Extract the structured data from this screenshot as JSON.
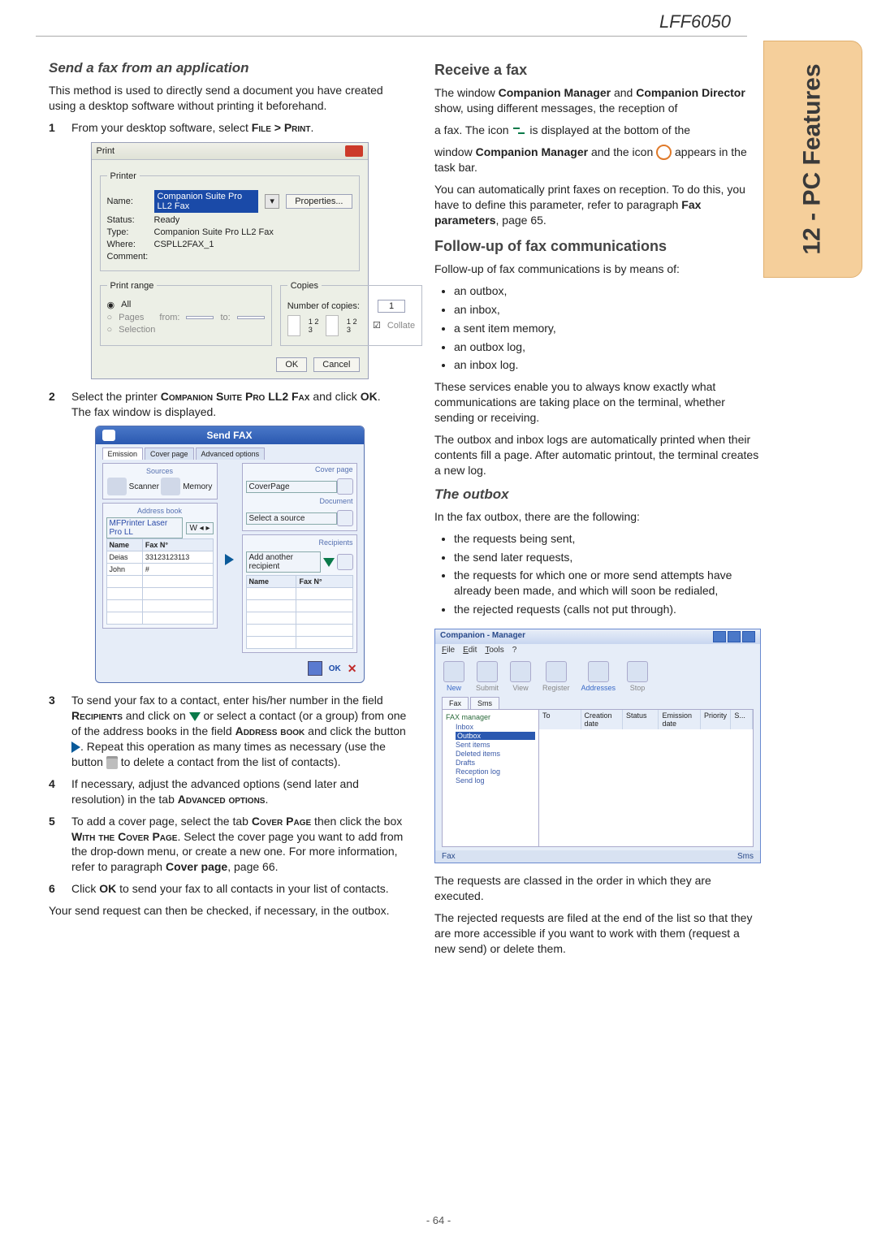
{
  "header": {
    "model": "LFF6050"
  },
  "side_tab": "12 - PC Features",
  "page_number": "- 64 -",
  "left": {
    "h_send_app": "Send a fax from an application",
    "p_intro": "This method is used to directly send a document you have created using a desktop software without printing it beforehand.",
    "step1": {
      "num": "1",
      "text_a": "From your desktop software, select ",
      "b": "File > Print",
      "text_c": "."
    },
    "step2": {
      "num": "2",
      "text_a": "Select the printer ",
      "b": "Companion Suite Pro LL2 Fax",
      "text_c": " and click ",
      "b2": "OK",
      "text_d": ".",
      "p2": "The fax window is displayed."
    },
    "step3": {
      "num": "3",
      "a": "To send your fax to a contact, enter his/her number in the field ",
      "b1": "Recipients",
      "c": " and click on ",
      "d": " or select a contact (or a group) from one of the address books in the field ",
      "b2": "Address book",
      "e": " and click the button ",
      "f": ". Repeat this operation as many times as necessary (use the button ",
      "g": " to delete a contact from the list of contacts)."
    },
    "step4": {
      "num": "4",
      "a": "If necessary, adjust the advanced options (send later and resolution) in the tab ",
      "b": "Advanced options",
      "c": "."
    },
    "step5": {
      "num": "5",
      "a": "To add a cover page, select the tab ",
      "b1": "Cover Page",
      "c": " then click the box ",
      "b2": "With the Cover Page",
      "d": ". Select the cover page you want to add from the drop-down menu, or create a new one. For more information, refer to paragraph ",
      "b3": "Cover page",
      "e": ", page 66."
    },
    "step6": {
      "num": "6",
      "a": "Click ",
      "b": "OK",
      "c": " to send your fax to all contacts in your list of contacts."
    },
    "p_out": "Your send request can then be checked, if necessary, in the outbox."
  },
  "right": {
    "h_receive": "Receive a fax",
    "p1a": "The window ",
    "p1b": "Companion Manager",
    "p1c": " and ",
    "p1d": "Companion Director",
    "p1e": " show, using different messages, the reception of",
    "p2a": "a fax. The icon ",
    "p2b": " is displayed at the bottom of the",
    "p3a": "window ",
    "p3b": "Companion Manager",
    "p3c": " and the icon ",
    "p3d": " appears in the task bar.",
    "p4a": "You can automatically print faxes on reception. To do this, you have to define this parameter, refer to paragraph ",
    "p4b": "Fax parameters",
    "p4c": ", page 65.",
    "h_follow": "Follow-up of fax communications",
    "p_follow": "Follow-up of fax communications is by means of:",
    "bul1": [
      "an outbox,",
      "an inbox,",
      "a sent item memory,",
      "an outbox log,",
      "an inbox log."
    ],
    "p5": "These services enable you to always know exactly what communications are taking place on the terminal, whether sending or receiving.",
    "p6": "The outbox and inbox logs are automatically printed when their contents fill a page. After automatic printout, the terminal creates a new log.",
    "h_outbox": "The outbox",
    "p_outbox_intro": "In the fax outbox, there are the following:",
    "bul2": [
      "the requests being sent,",
      "the send later requests,",
      "the requests for which one or more send attempts have already been made, and which will soon be redialed,",
      "the rejected requests (calls not put through)."
    ],
    "p7": "The requests are classed in the order in which they are executed.",
    "p8": "The rejected requests are filed at the end of the list so that they are more accessible if you want to work with them (request a new send) or delete them."
  },
  "print_dialog": {
    "title": "Print",
    "printer_legend": "Printer",
    "name": "Name:",
    "name_val": "Companion Suite Pro LL2 Fax",
    "properties": "Properties...",
    "status": "Status:",
    "status_v": "Ready",
    "type": "Type:",
    "type_v": "Companion Suite Pro LL2 Fax",
    "where": "Where:",
    "where_v": "CSPLL2FAX_1",
    "comment": "Comment:",
    "range_legend": "Print range",
    "all": "All",
    "pages": "Pages",
    "from": "from:",
    "to": "to:",
    "selection": "Selection",
    "copies_legend": "Copies",
    "num_copies": "Number of copies:",
    "num_v": "1",
    "collate": "Collate",
    "ok": "OK",
    "cancel": "Cancel",
    "pgmark": "1 2 3"
  },
  "fax_window": {
    "title": "Send FAX",
    "tabs": [
      "Emission",
      "Cover page",
      "Advanced options"
    ],
    "sources": "Sources",
    "scanner": "Scanner",
    "memory": "Memory",
    "addrbook": "Address book",
    "addr_sel": "MFPrinter Laser Pro LL",
    "addr_btns": "W ◂ ▸",
    "col_name": "Name",
    "col_fax": "Fax N°",
    "row1_name": "Deias",
    "row1_fax": "33123123113",
    "row2_name": "John",
    "row2_fax": "#",
    "cover_page": "Cover page",
    "cov_lbl": "CoverPage",
    "document": "Document",
    "sel_source": "Select a source",
    "recipients": "Recipients",
    "add_rec": "Add another recipient",
    "ok": "OK"
  },
  "mgr_window": {
    "title": "Companion - Manager",
    "menu": [
      "File",
      "Edit",
      "Tools",
      "?"
    ],
    "toolbar": [
      "New",
      "Submit",
      "View",
      "Register",
      "Addresses",
      "Stop"
    ],
    "tabs": [
      "Fax",
      "Sms"
    ],
    "tree_root": "FAX manager",
    "tree": [
      "Inbox",
      "Outbox",
      "Sent items",
      "Deleted items",
      "Drafts",
      "Reception log",
      "Send log"
    ],
    "tree_selected_index": 1,
    "grid_headers": [
      "To",
      "Creation date",
      "Status",
      "Emission date",
      "Priority",
      "S..."
    ],
    "status_l": "Fax",
    "status_r": "Sms"
  }
}
